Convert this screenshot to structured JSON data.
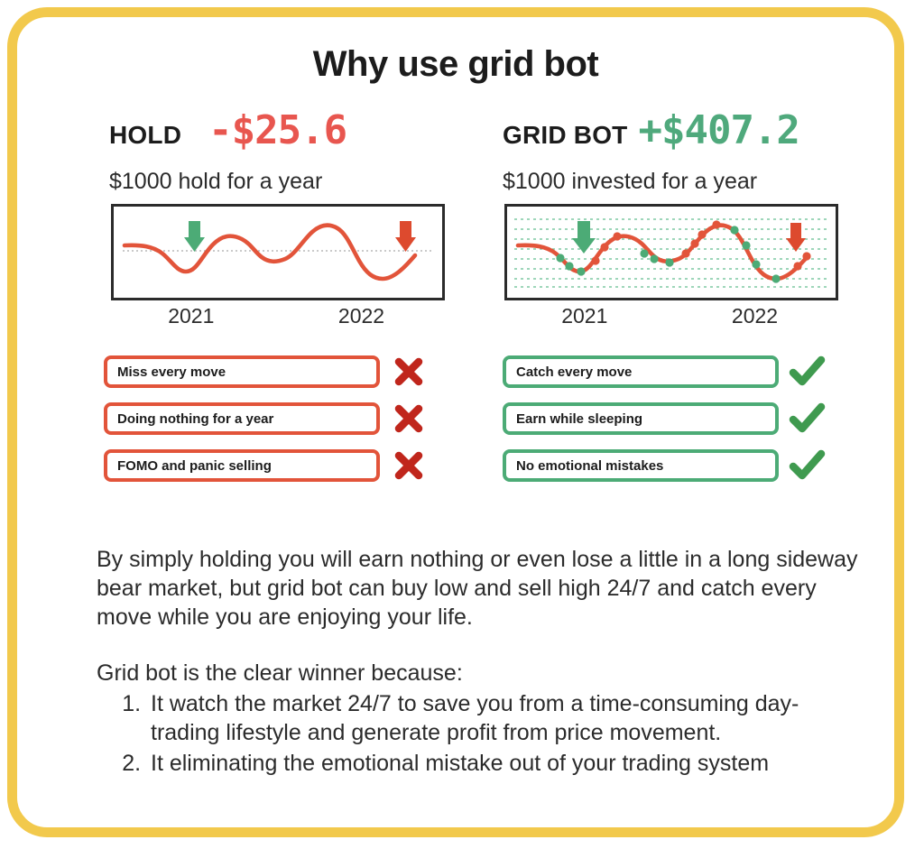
{
  "title": "Why use grid bot",
  "colors": {
    "frame_border": "#f2c94c",
    "negative": "#e8564f",
    "positive": "#4fa97c",
    "line": "#e2543a",
    "buy_marker": "#4cab76",
    "sell_marker": "#e2543a",
    "cross": "#c0261c",
    "check": "#3f9a4f",
    "grid": "#7fc9a4",
    "chart_border": "#2b2b2b"
  },
  "columns": [
    {
      "label": "HOLD",
      "value": "-$25.6",
      "value_sign": "negative",
      "caption": "$1000 hold for a year",
      "axis": [
        "2021",
        "2022"
      ],
      "features": [
        {
          "text": "Miss every move",
          "mark": "cross-icon"
        },
        {
          "text": "Doing nothing for a year",
          "mark": "cross-icon"
        },
        {
          "text": "FOMO and panic selling",
          "mark": "cross-icon"
        }
      ]
    },
    {
      "label": "GRID BOT",
      "value": "+$407.2",
      "value_sign": "positive",
      "caption": "$1000 invested for a year",
      "axis": [
        "2021",
        "2022"
      ],
      "features": [
        {
          "text": "Catch every move",
          "mark": "check-icon"
        },
        {
          "text": "Earn while sleeping",
          "mark": "check-icon"
        },
        {
          "text": "No emotional mistakes",
          "mark": "check-icon"
        }
      ]
    }
  ],
  "body": {
    "paragraph_1": "By simply holding you will earn nothing or even lose a little in a long sideway bear market, but grid bot can buy low and sell high 24/7 and catch every move while you are enjoying your life.",
    "paragraph_2": "Grid bot is the clear winner because:",
    "list": [
      "It watch the market 24/7 to save you from a time-consuming day-trading lifestyle and generate profit from price movement.",
      "It eliminating the emotional mistake out of your trading system"
    ]
  },
  "chart_data": [
    {
      "type": "line",
      "name": "hold-price-chart",
      "title": "$1000 hold for a year",
      "xlabel": "",
      "ylabel": "",
      "xticklabels": [
        "2021",
        "2022"
      ],
      "grid": false,
      "reference_line": true,
      "xlim": [
        0,
        100
      ],
      "ylim": [
        0,
        100
      ],
      "series": [
        {
          "name": "price",
          "color": "#e2543a",
          "x": [
            2,
            10,
            16,
            21,
            26,
            32,
            38,
            44,
            50,
            56,
            62,
            68,
            74,
            80,
            86,
            92,
            97
          ],
          "y": [
            57,
            56,
            50,
            40,
            34,
            38,
            52,
            62,
            60,
            50,
            42,
            44,
            62,
            78,
            80,
            62,
            40
          ]
        }
      ],
      "annotations": [
        {
          "type": "arrow-down",
          "label": "buy",
          "color": "#4cab76",
          "x": 24,
          "y": 52
        },
        {
          "type": "arrow-down",
          "label": "sell",
          "color": "#e2543a",
          "x": 92,
          "y": 52
        }
      ]
    },
    {
      "type": "line",
      "name": "grid-bot-price-chart",
      "title": "$1000 invested for a year",
      "xlabel": "",
      "ylabel": "",
      "xticklabels": [
        "2021",
        "2022"
      ],
      "grid": true,
      "grid_levels": [
        14,
        25,
        36,
        47,
        58,
        69,
        80,
        88
      ],
      "xlim": [
        0,
        100
      ],
      "ylim": [
        0,
        100
      ],
      "series": [
        {
          "name": "price",
          "color": "#e2543a",
          "x": [
            2,
            10,
            16,
            21,
            26,
            32,
            38,
            44,
            50,
            56,
            62,
            68,
            74,
            80,
            86,
            92,
            97
          ],
          "y": [
            57,
            56,
            50,
            40,
            34,
            38,
            52,
            62,
            60,
            50,
            42,
            44,
            62,
            78,
            80,
            62,
            40
          ]
        }
      ],
      "markers": [
        {
          "kind": "buy",
          "color": "#4cab76",
          "x": 17,
          "y": 50
        },
        {
          "kind": "buy",
          "color": "#4cab76",
          "x": 20,
          "y": 43
        },
        {
          "kind": "buy",
          "color": "#4cab76",
          "x": 25,
          "y": 35
        },
        {
          "kind": "sell",
          "color": "#e2543a",
          "x": 32,
          "y": 39
        },
        {
          "kind": "sell",
          "color": "#e2543a",
          "x": 36,
          "y": 48
        },
        {
          "kind": "sell",
          "color": "#e2543a",
          "x": 40,
          "y": 57
        },
        {
          "kind": "buy",
          "color": "#4cab76",
          "x": 47,
          "y": 61
        },
        {
          "kind": "buy",
          "color": "#4cab76",
          "x": 51,
          "y": 54
        },
        {
          "kind": "buy",
          "color": "#4cab76",
          "x": 56,
          "y": 44
        },
        {
          "kind": "sell",
          "color": "#e2543a",
          "x": 64,
          "y": 50
        },
        {
          "kind": "sell",
          "color": "#e2543a",
          "x": 68,
          "y": 62
        },
        {
          "kind": "sell",
          "color": "#e2543a",
          "x": 72,
          "y": 73
        },
        {
          "kind": "buy",
          "color": "#4cab76",
          "x": 80,
          "y": 79
        },
        {
          "kind": "buy",
          "color": "#4cab76",
          "x": 84,
          "y": 68
        },
        {
          "kind": "buy",
          "color": "#4cab76",
          "x": 88,
          "y": 52
        },
        {
          "kind": "buy",
          "color": "#4cab76",
          "x": 92,
          "y": 38
        },
        {
          "kind": "sell",
          "color": "#e2543a",
          "x": 96,
          "y": 44
        }
      ],
      "annotations": [
        {
          "type": "arrow-down",
          "label": "buy",
          "color": "#4cab76",
          "x": 22,
          "y": 50
        },
        {
          "type": "arrow-down",
          "label": "sell",
          "color": "#e2543a",
          "x": 92,
          "y": 50
        }
      ]
    }
  ]
}
